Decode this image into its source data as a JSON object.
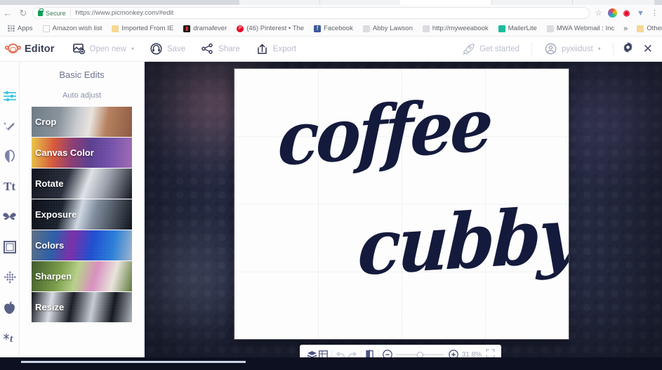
{
  "browser": {
    "reload_icon": "reload-icon",
    "back_icon": "back-icon",
    "security_label": "Secure",
    "url": "https://www.picmonkey.com/#edit",
    "star_icon": "bookmark-star-icon",
    "ext1_icon": "color-palette-extension-icon",
    "ext2_icon": "pinterest-save-extension-icon",
    "ext3_icon": "download-extension-icon",
    "menu_icon": "chrome-menu-icon",
    "bookmarks": [
      {
        "label": "Apps",
        "icon": "apps-grid-icon"
      },
      {
        "label": "Amazon wish list",
        "icon": "document-icon"
      },
      {
        "label": "Imported From IE",
        "icon": "folder-icon"
      },
      {
        "label": "dramafever",
        "icon": "dramafever-icon"
      },
      {
        "label": "(46) Pinterest • The",
        "icon": "pinterest-icon"
      },
      {
        "label": "Facebook",
        "icon": "facebook-icon"
      },
      {
        "label": "Abby Lawson",
        "icon": "generic-site-icon"
      },
      {
        "label": "http://myweeabook",
        "icon": "generic-site-icon"
      },
      {
        "label": "MailerLite",
        "icon": "mailerlite-icon"
      },
      {
        "label": "MWA Webmail : Inc",
        "icon": "generic-site-icon"
      }
    ],
    "overflow_label": "»",
    "other_bookmarks": {
      "label": "Other bookmarks",
      "icon": "folder-icon"
    }
  },
  "app": {
    "name": "Editor",
    "logo_icon": "picmonkey-monkey-icon",
    "toolbar": [
      {
        "label": "Open new",
        "icon": "open-new-image-icon",
        "caret": "▾"
      },
      {
        "label": "Save",
        "icon": "save-headphones-icon",
        "caret": ""
      },
      {
        "label": "Share",
        "icon": "share-nodes-icon",
        "caret": ""
      },
      {
        "label": "Export",
        "icon": "export-upload-icon",
        "caret": ""
      }
    ],
    "get_started": {
      "label": "Get started",
      "icon": "rocket-icon"
    },
    "account": {
      "label": "pyxiidust",
      "icon": "user-avatar-icon",
      "caret": "▾"
    },
    "settings_icon": "gear-icon",
    "close_icon": "close-icon"
  },
  "rail": [
    {
      "name": "basic-edits",
      "icon": "sliders-icon",
      "glyph": "≡",
      "active": true
    },
    {
      "name": "effects",
      "icon": "magic-wand-icon",
      "glyph": "✦",
      "active": false
    },
    {
      "name": "touch-up",
      "icon": "face-portrait-icon",
      "glyph": "☺",
      "active": false
    },
    {
      "name": "text",
      "icon": "text-tt-icon",
      "glyph": "Tt",
      "active": false
    },
    {
      "name": "overlays",
      "icon": "butterfly-icon",
      "glyph": "❧",
      "active": false
    },
    {
      "name": "frames",
      "icon": "frame-icon",
      "glyph": "▢",
      "active": false
    },
    {
      "name": "textures",
      "icon": "texture-diamond-icon",
      "glyph": "❖",
      "active": false
    },
    {
      "name": "themes",
      "icon": "apple-icon",
      "glyph": "●",
      "active": false
    },
    {
      "name": "seasonal",
      "icon": "snowflake-text-icon",
      "glyph": "t",
      "active": false
    }
  ],
  "panel": {
    "title": "Basic Edits",
    "auto_adjust": "Auto adjust",
    "items": [
      {
        "label": "Crop",
        "thumb": "tb-crop"
      },
      {
        "label": "Canvas Color",
        "thumb": "tb-canvas"
      },
      {
        "label": "Rotate",
        "thumb": "tb-rotate"
      },
      {
        "label": "Exposure",
        "thumb": "tb-expo"
      },
      {
        "label": "Colors",
        "thumb": "tb-colors"
      },
      {
        "label": "Sharpen",
        "thumb": "tb-sharp"
      },
      {
        "label": "Resize",
        "thumb": "tb-resize"
      }
    ]
  },
  "canvas": {
    "line1": "coffee",
    "line2": "cubby",
    "text_color": "#141a3c",
    "background_color": "#fdfdfd"
  },
  "bottombar": {
    "layers_icon": "layers-icon",
    "grid_icon": "grid-icon",
    "undo_icon": "undo-icon",
    "redo_icon": "redo-icon",
    "compare_icon": "before-after-compare-icon",
    "zoom_out_icon": "zoom-out-icon",
    "zoom_in_icon": "zoom-in-icon",
    "zoom_level": "31.8%",
    "fullscreen_icon": "fit-to-screen-icon"
  }
}
